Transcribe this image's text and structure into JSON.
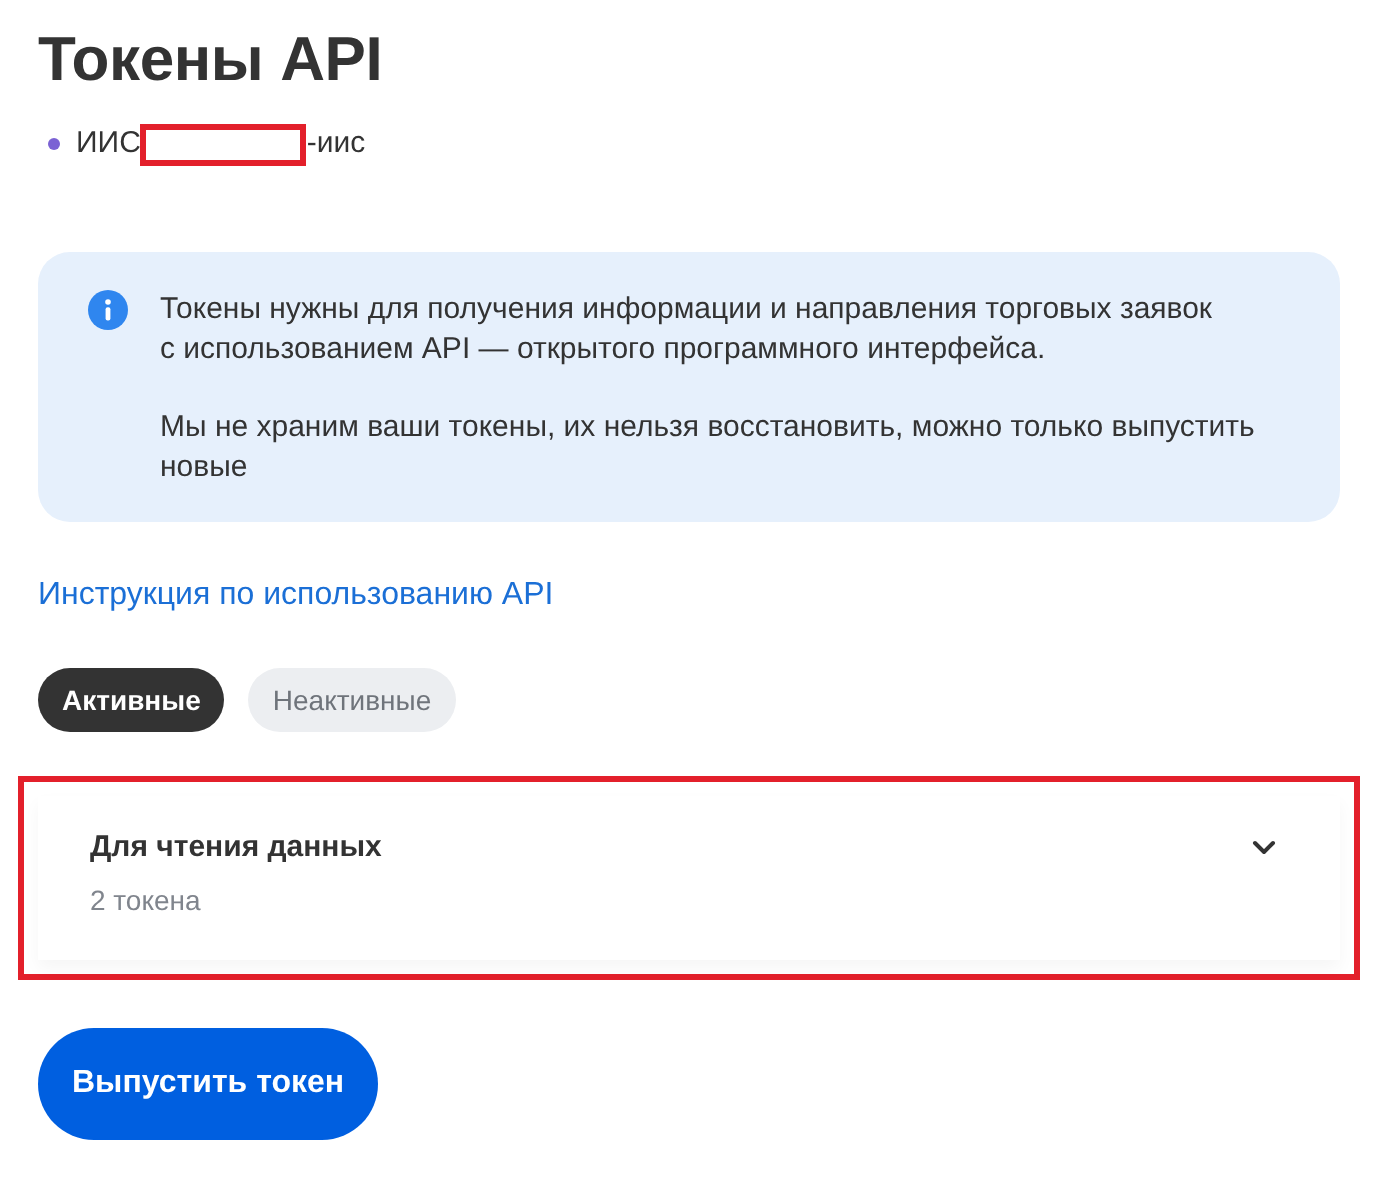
{
  "page": {
    "title": "Токены API"
  },
  "account": {
    "prefix": "ИИС",
    "suffix": "-иис",
    "redacted": true
  },
  "info": {
    "paragraphs": [
      "Токены нужны для получения информации и направления торговых заявок с использованием API — открытого программного интерфейса.",
      "Мы не храним ваши токены, их нельзя восстановить, можно только выпустить новые"
    ]
  },
  "help_link": "Инструкция по использованию API",
  "tabs": [
    {
      "label": "Активные",
      "selected": true
    },
    {
      "label": "Неактивные",
      "selected": false
    }
  ],
  "token_groups": [
    {
      "title": "Для чтения данных",
      "count": "2 токена",
      "expanded": false,
      "highlighted": true
    }
  ],
  "buttons": [
    {
      "label": "Выпустить токен"
    }
  ]
}
